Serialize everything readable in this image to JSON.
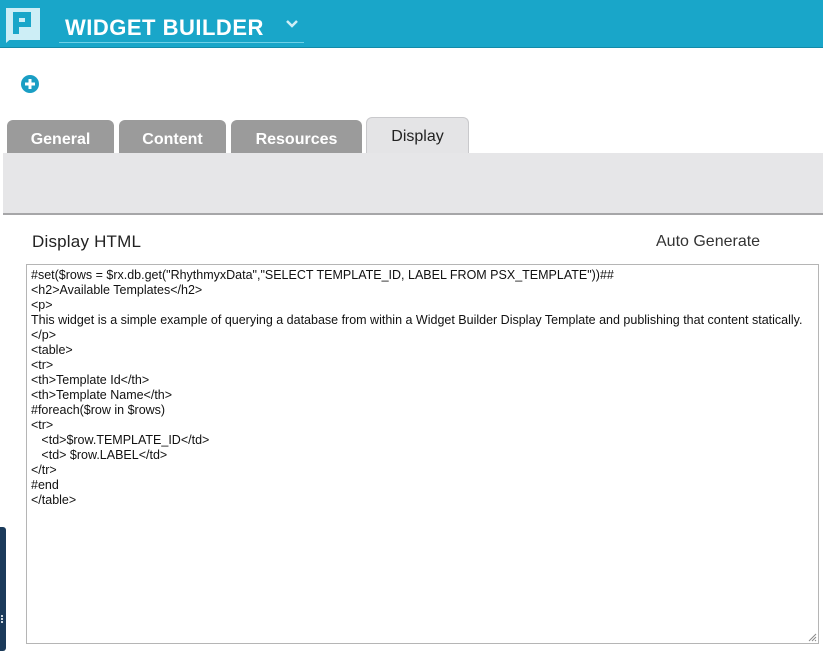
{
  "header": {
    "app_title": "WIDGET BUILDER",
    "logo_icon": "percussion-logo-icon",
    "chevron_icon": "chevron-down-icon",
    "bar_color": "#19a6c9"
  },
  "toolbar": {
    "add_icon": "plus-circle-icon"
  },
  "tabs": [
    {
      "label": "General",
      "active": false
    },
    {
      "label": "Content",
      "active": false
    },
    {
      "label": "Resources",
      "active": false
    },
    {
      "label": "Display",
      "active": true
    }
  ],
  "display": {
    "section_label": "Display HTML",
    "auto_generate_label": "Auto Generate",
    "code_lines": [
      "#set($rows = $rx.db.get(\"RhythmyxData\",\"SELECT TEMPLATE_ID, LABEL FROM PSX_TEMPLATE\"))##",
      "<h2>Available Templates</h2>",
      "<p>",
      "This widget is a simple example of querying a database from within a Widget Builder Display Template and publishing that content statically.",
      "</p>",
      "<table>",
      "<tr>",
      "<th>Template Id</th>",
      "<th>Template Name</th>",
      "#foreach($row in $rows)",
      "<tr>",
      "   <td>$row.TEMPLATE_ID</td>",
      "   <td> $row.LABEL</td>",
      "</tr>",
      "#end",
      "</table>"
    ]
  }
}
